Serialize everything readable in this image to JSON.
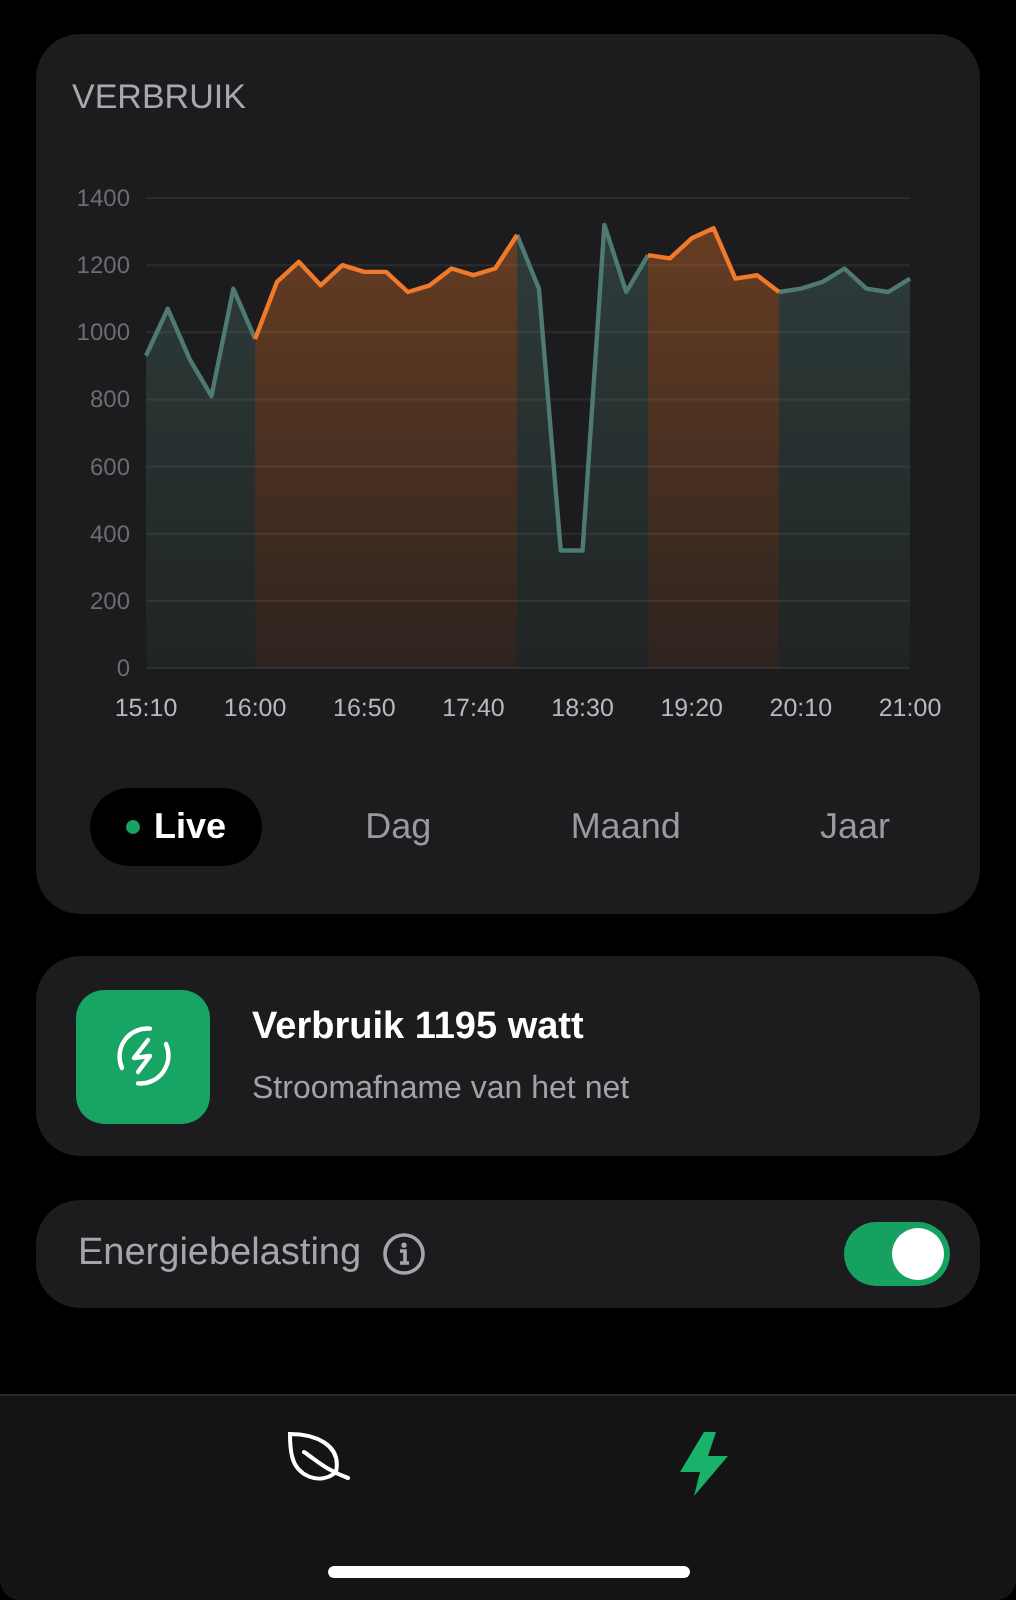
{
  "usage_card": {
    "title": "VERBRUIK",
    "chart_data": {
      "type": "area",
      "grid": true,
      "categories": [
        "15:10",
        null,
        null,
        null,
        null,
        "16:00",
        null,
        null,
        null,
        null,
        "16:50",
        null,
        null,
        null,
        null,
        "17:40",
        null,
        null,
        null,
        null,
        "18:30",
        null,
        null,
        null,
        null,
        "19:20",
        null,
        null,
        null,
        null,
        "20:10",
        null,
        null,
        null,
        null,
        "21:00"
      ],
      "series": [
        {
          "color": "#4e7a70",
          "values": [
            930,
            1070,
            920,
            810,
            1130,
            980,
            null,
            null,
            null,
            null,
            null,
            null,
            null,
            null,
            null,
            null,
            null,
            1290,
            1130,
            350,
            350,
            1320,
            1120,
            1230,
            null,
            null,
            null,
            null,
            null,
            1120,
            1130,
            1150,
            1190,
            1130,
            1120,
            1160
          ]
        },
        {
          "color": "#f07a2a",
          "values": [
            null,
            null,
            null,
            null,
            null,
            980,
            1150,
            1210,
            1140,
            1200,
            1180,
            1180,
            1120,
            1140,
            1190,
            1170,
            1190,
            1290,
            null,
            null,
            null,
            null,
            null,
            1230,
            1220,
            1280,
            1310,
            1160,
            1170,
            1120,
            null,
            null,
            null,
            null,
            null,
            null
          ]
        }
      ],
      "ylim": [
        0,
        1400
      ],
      "yticks": [
        0,
        200,
        400,
        600,
        800,
        1000,
        1200,
        1400
      ]
    },
    "periods": [
      {
        "label": "Live",
        "selected": true
      },
      {
        "label": "Dag",
        "selected": false
      },
      {
        "label": "Maand",
        "selected": false
      },
      {
        "label": "Jaar",
        "selected": false
      }
    ]
  },
  "status_card": {
    "title": "Verbruik 1195 watt",
    "subtitle": "Stroomafname van het net"
  },
  "setting": {
    "label": "Energiebelasting",
    "on": true
  },
  "nav": [
    {
      "kind": "leaf",
      "selected": false
    },
    {
      "kind": "bolt",
      "selected": true
    }
  ]
}
